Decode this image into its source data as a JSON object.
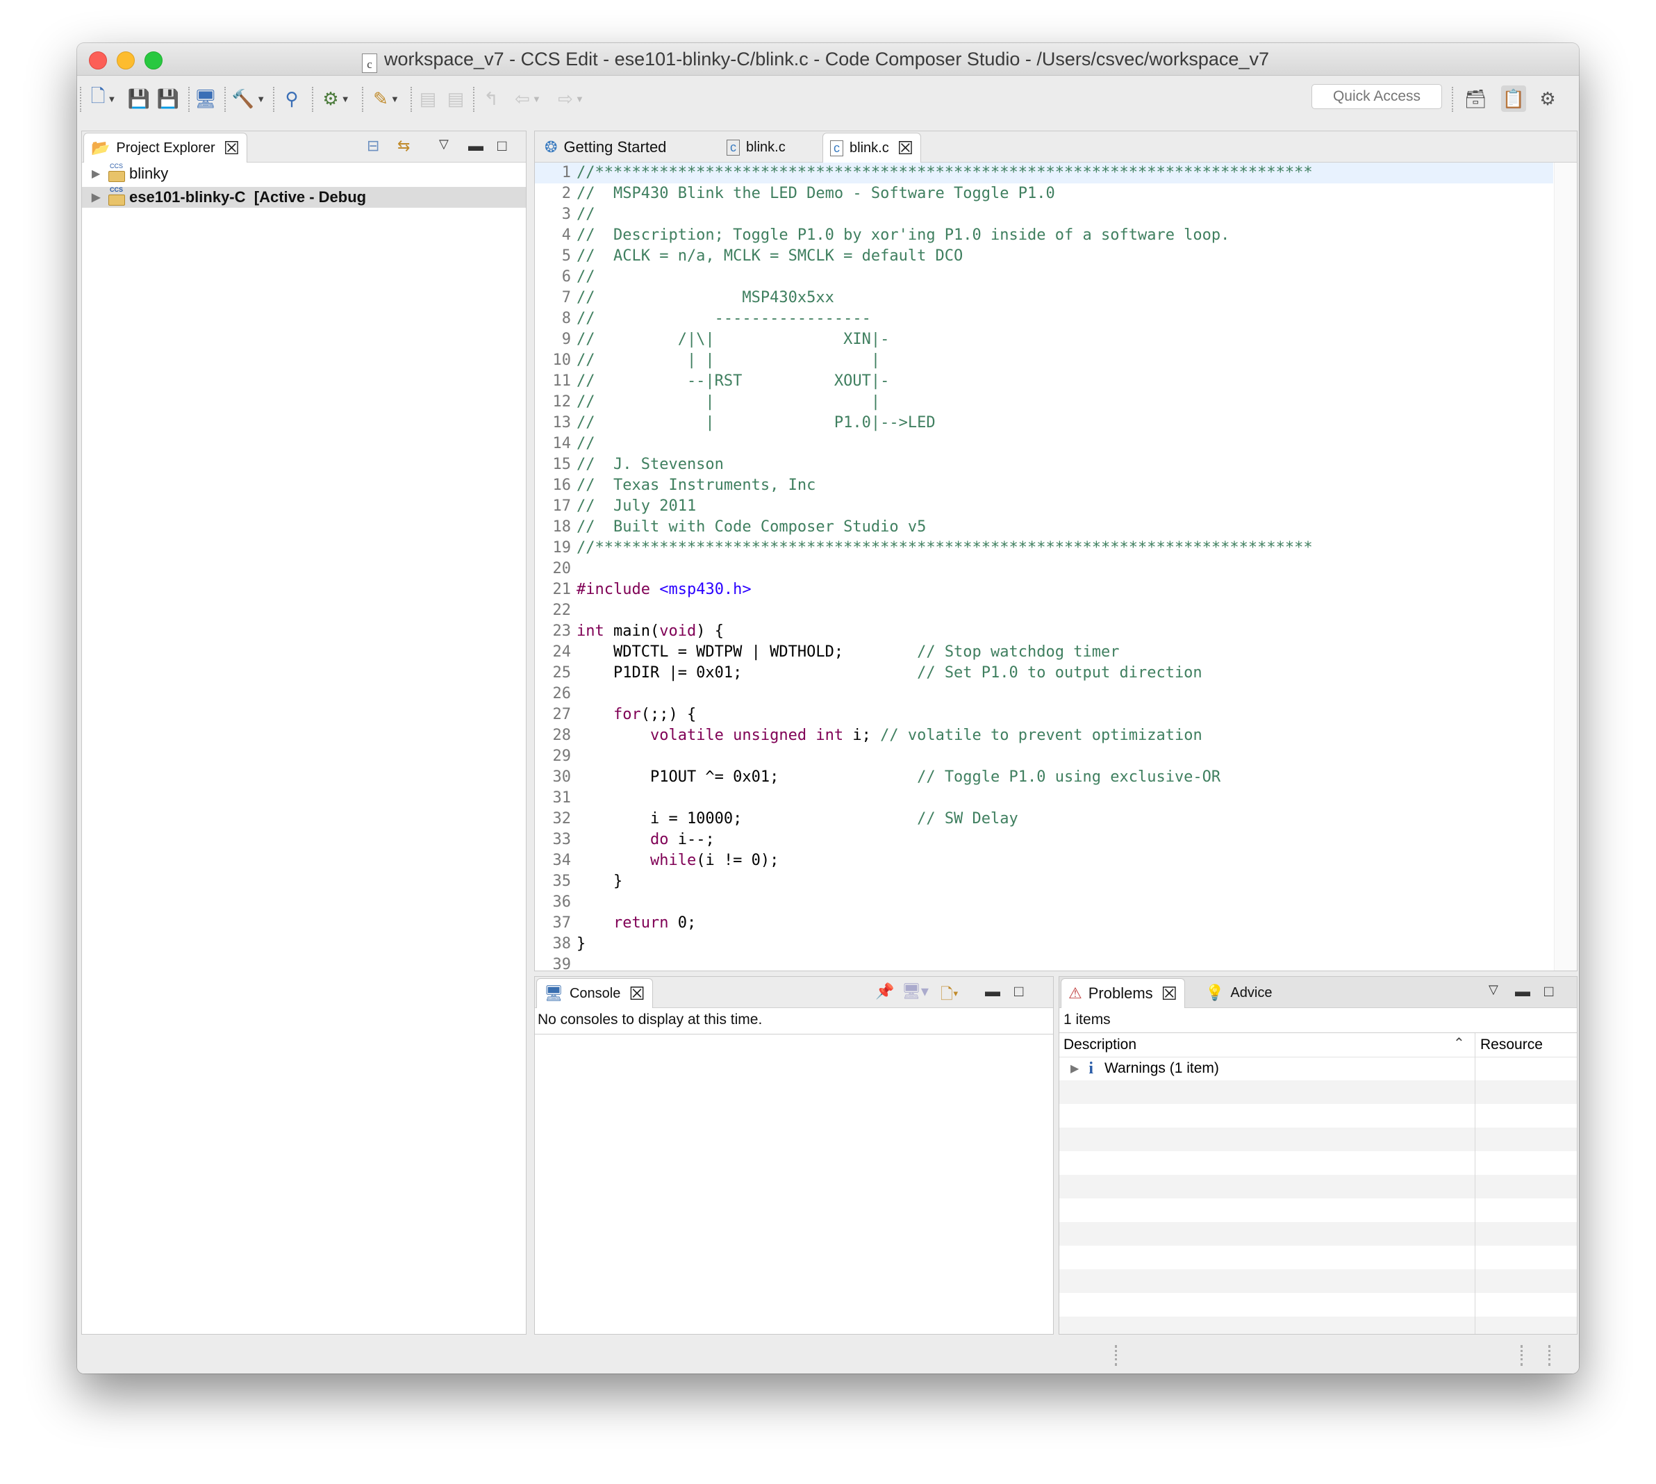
{
  "window": {
    "title": "workspace_v7 - CCS Edit - ese101-blinky-C/blink.c - Code Composer Studio - /Users/csvec/workspace_v7",
    "title_file_icon": "c"
  },
  "toolbar": {
    "quick_access_placeholder": "Quick Access"
  },
  "project_explorer": {
    "tab_label": "Project Explorer",
    "items": [
      {
        "label": "blinky",
        "bold": false
      },
      {
        "label": "ese101-blinky-C  [Active - Debug",
        "bold": true
      }
    ]
  },
  "editor": {
    "tabs": [
      {
        "label": "Getting Started"
      },
      {
        "label": "blink.c"
      },
      {
        "label": "blink.c",
        "active": true
      }
    ],
    "lines": [
      {
        "n": "1",
        "segs": [
          {
            "t": "//******************************************************************************",
            "k": "com"
          }
        ]
      },
      {
        "n": "2",
        "segs": [
          {
            "t": "//  MSP430 Blink the LED Demo - Software Toggle P1.0",
            "k": "com"
          }
        ]
      },
      {
        "n": "3",
        "segs": [
          {
            "t": "//",
            "k": "com"
          }
        ]
      },
      {
        "n": "4",
        "segs": [
          {
            "t": "//  Description; Toggle P1.0 by xor'ing P1.0 inside of a software loop.",
            "k": "com"
          }
        ]
      },
      {
        "n": "5",
        "segs": [
          {
            "t": "//  ACLK = n/a, MCLK = SMCLK = default DCO",
            "k": "com"
          }
        ]
      },
      {
        "n": "6",
        "segs": [
          {
            "t": "//",
            "k": "com"
          }
        ]
      },
      {
        "n": "7",
        "segs": [
          {
            "t": "//                MSP430x5xx",
            "k": "com"
          }
        ]
      },
      {
        "n": "8",
        "segs": [
          {
            "t": "//             -----------------",
            "k": "com"
          }
        ]
      },
      {
        "n": "9",
        "segs": [
          {
            "t": "//         /|\\|              XIN|-",
            "k": "com"
          }
        ]
      },
      {
        "n": "10",
        "segs": [
          {
            "t": "//          | |                 |",
            "k": "com"
          }
        ]
      },
      {
        "n": "11",
        "segs": [
          {
            "t": "//          --|RST          XOUT|-",
            "k": "com"
          }
        ]
      },
      {
        "n": "12",
        "segs": [
          {
            "t": "//            |                 |",
            "k": "com"
          }
        ]
      },
      {
        "n": "13",
        "segs": [
          {
            "t": "//            |             P1.0|-->LED",
            "k": "com"
          }
        ]
      },
      {
        "n": "14",
        "segs": [
          {
            "t": "//",
            "k": "com"
          }
        ]
      },
      {
        "n": "15",
        "segs": [
          {
            "t": "//  J. Stevenson",
            "k": "com"
          }
        ]
      },
      {
        "n": "16",
        "segs": [
          {
            "t": "//  Texas Instruments, Inc",
            "k": "com"
          }
        ]
      },
      {
        "n": "17",
        "segs": [
          {
            "t": "//  July 2011",
            "k": "com"
          }
        ]
      },
      {
        "n": "18",
        "segs": [
          {
            "t": "//  Built with Code Composer Studio v5",
            "k": "com"
          }
        ]
      },
      {
        "n": "19",
        "segs": [
          {
            "t": "//******************************************************************************",
            "k": "com"
          }
        ]
      },
      {
        "n": "20",
        "segs": []
      },
      {
        "n": "21",
        "segs": [
          {
            "t": "#include ",
            "k": "kw"
          },
          {
            "t": "<msp430.h>",
            "k": "str"
          }
        ]
      },
      {
        "n": "22",
        "segs": []
      },
      {
        "n": "23",
        "segs": [
          {
            "t": "int",
            "k": "kw"
          },
          {
            "t": " main(",
            "k": "plain"
          },
          {
            "t": "void",
            "k": "kw"
          },
          {
            "t": ") {",
            "k": "plain"
          }
        ]
      },
      {
        "n": "24",
        "segs": [
          {
            "t": "    WDTCTL = WDTPW | WDTHOLD;        ",
            "k": "plain"
          },
          {
            "t": "// Stop watchdog timer",
            "k": "com"
          }
        ]
      },
      {
        "n": "25",
        "segs": [
          {
            "t": "    P1DIR |= 0x01;                   ",
            "k": "plain"
          },
          {
            "t": "// Set P1.0 to output direction",
            "k": "com"
          }
        ]
      },
      {
        "n": "26",
        "segs": []
      },
      {
        "n": "27",
        "segs": [
          {
            "t": "    ",
            "k": "plain"
          },
          {
            "t": "for",
            "k": "kw"
          },
          {
            "t": "(;;) {",
            "k": "plain"
          }
        ]
      },
      {
        "n": "28",
        "segs": [
          {
            "t": "        ",
            "k": "plain"
          },
          {
            "t": "volatile unsigned int",
            "k": "kw"
          },
          {
            "t": " i; ",
            "k": "plain"
          },
          {
            "t": "// volatile to prevent optimization",
            "k": "com"
          }
        ]
      },
      {
        "n": "29",
        "segs": []
      },
      {
        "n": "30",
        "segs": [
          {
            "t": "        P1OUT ^= 0x01;               ",
            "k": "plain"
          },
          {
            "t": "// Toggle P1.0 using exclusive-OR",
            "k": "com"
          }
        ]
      },
      {
        "n": "31",
        "segs": []
      },
      {
        "n": "32",
        "segs": [
          {
            "t": "        i = 10000;                   ",
            "k": "plain"
          },
          {
            "t": "// SW Delay",
            "k": "com"
          }
        ]
      },
      {
        "n": "33",
        "segs": [
          {
            "t": "        ",
            "k": "plain"
          },
          {
            "t": "do",
            "k": "kw"
          },
          {
            "t": " i--;",
            "k": "plain"
          }
        ]
      },
      {
        "n": "34",
        "segs": [
          {
            "t": "        ",
            "k": "plain"
          },
          {
            "t": "while",
            "k": "kw"
          },
          {
            "t": "(i != 0);",
            "k": "plain"
          }
        ]
      },
      {
        "n": "35",
        "segs": [
          {
            "t": "    }",
            "k": "plain"
          }
        ]
      },
      {
        "n": "36",
        "segs": []
      },
      {
        "n": "37",
        "segs": [
          {
            "t": "    ",
            "k": "plain"
          },
          {
            "t": "return",
            "k": "kw"
          },
          {
            "t": " 0;",
            "k": "plain"
          }
        ]
      },
      {
        "n": "38",
        "segs": [
          {
            "t": "}",
            "k": "plain"
          }
        ]
      },
      {
        "n": "39",
        "segs": []
      }
    ]
  },
  "console": {
    "tab_label": "Console",
    "message": "No consoles to display at this time."
  },
  "problems": {
    "tab_label": "Problems",
    "advice_label": "Advice",
    "count_text": "1 items",
    "columns": [
      "Description",
      "Resource"
    ],
    "rows": [
      {
        "description": "Warnings (1 item)",
        "resource": ""
      }
    ]
  }
}
